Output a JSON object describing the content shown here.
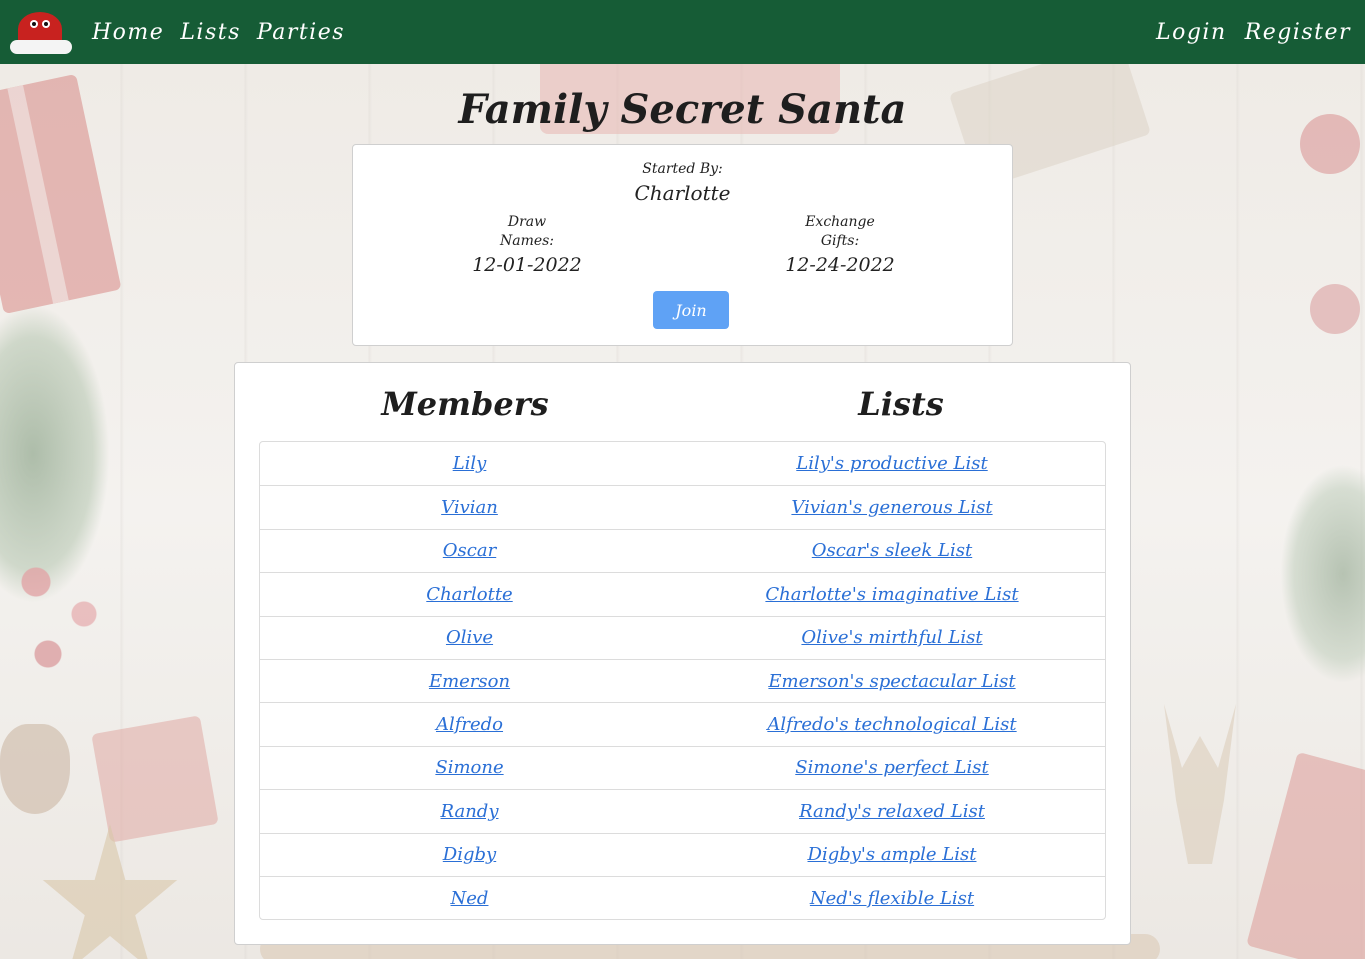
{
  "nav": {
    "left": [
      "Home",
      "Lists",
      "Parties"
    ],
    "right": [
      "Login",
      "Register"
    ]
  },
  "party": {
    "title": "Family Secret Santa",
    "started_by_label": "Started By:",
    "started_by": "Charlotte",
    "draw_label": "Draw Names:",
    "draw_date": "12-01-2022",
    "exchange_label": "Exchange Gifts:",
    "exchange_date": "12-24-2022",
    "join_label": "Join"
  },
  "table": {
    "members_heading": "Members",
    "lists_heading": "Lists",
    "rows": [
      {
        "member": "Lily",
        "list": "Lily's productive List"
      },
      {
        "member": "Vivian",
        "list": "Vivian's generous List"
      },
      {
        "member": "Oscar",
        "list": "Oscar's sleek List"
      },
      {
        "member": "Charlotte",
        "list": "Charlotte's imaginative List"
      },
      {
        "member": "Olive",
        "list": "Olive's mirthful List"
      },
      {
        "member": "Emerson",
        "list": "Emerson's spectacular List"
      },
      {
        "member": "Alfredo",
        "list": "Alfredo's technological List"
      },
      {
        "member": "Simone",
        "list": "Simone's perfect List"
      },
      {
        "member": "Randy",
        "list": "Randy's relaxed List"
      },
      {
        "member": "Digby",
        "list": "Digby's ample List"
      },
      {
        "member": "Ned",
        "list": "Ned's flexible List"
      }
    ]
  },
  "colors": {
    "navbar": "#165c36",
    "link": "#2a6fd6",
    "button": "#5fa2f5"
  },
  "icons": {
    "logo": "santa-hat-icon"
  }
}
